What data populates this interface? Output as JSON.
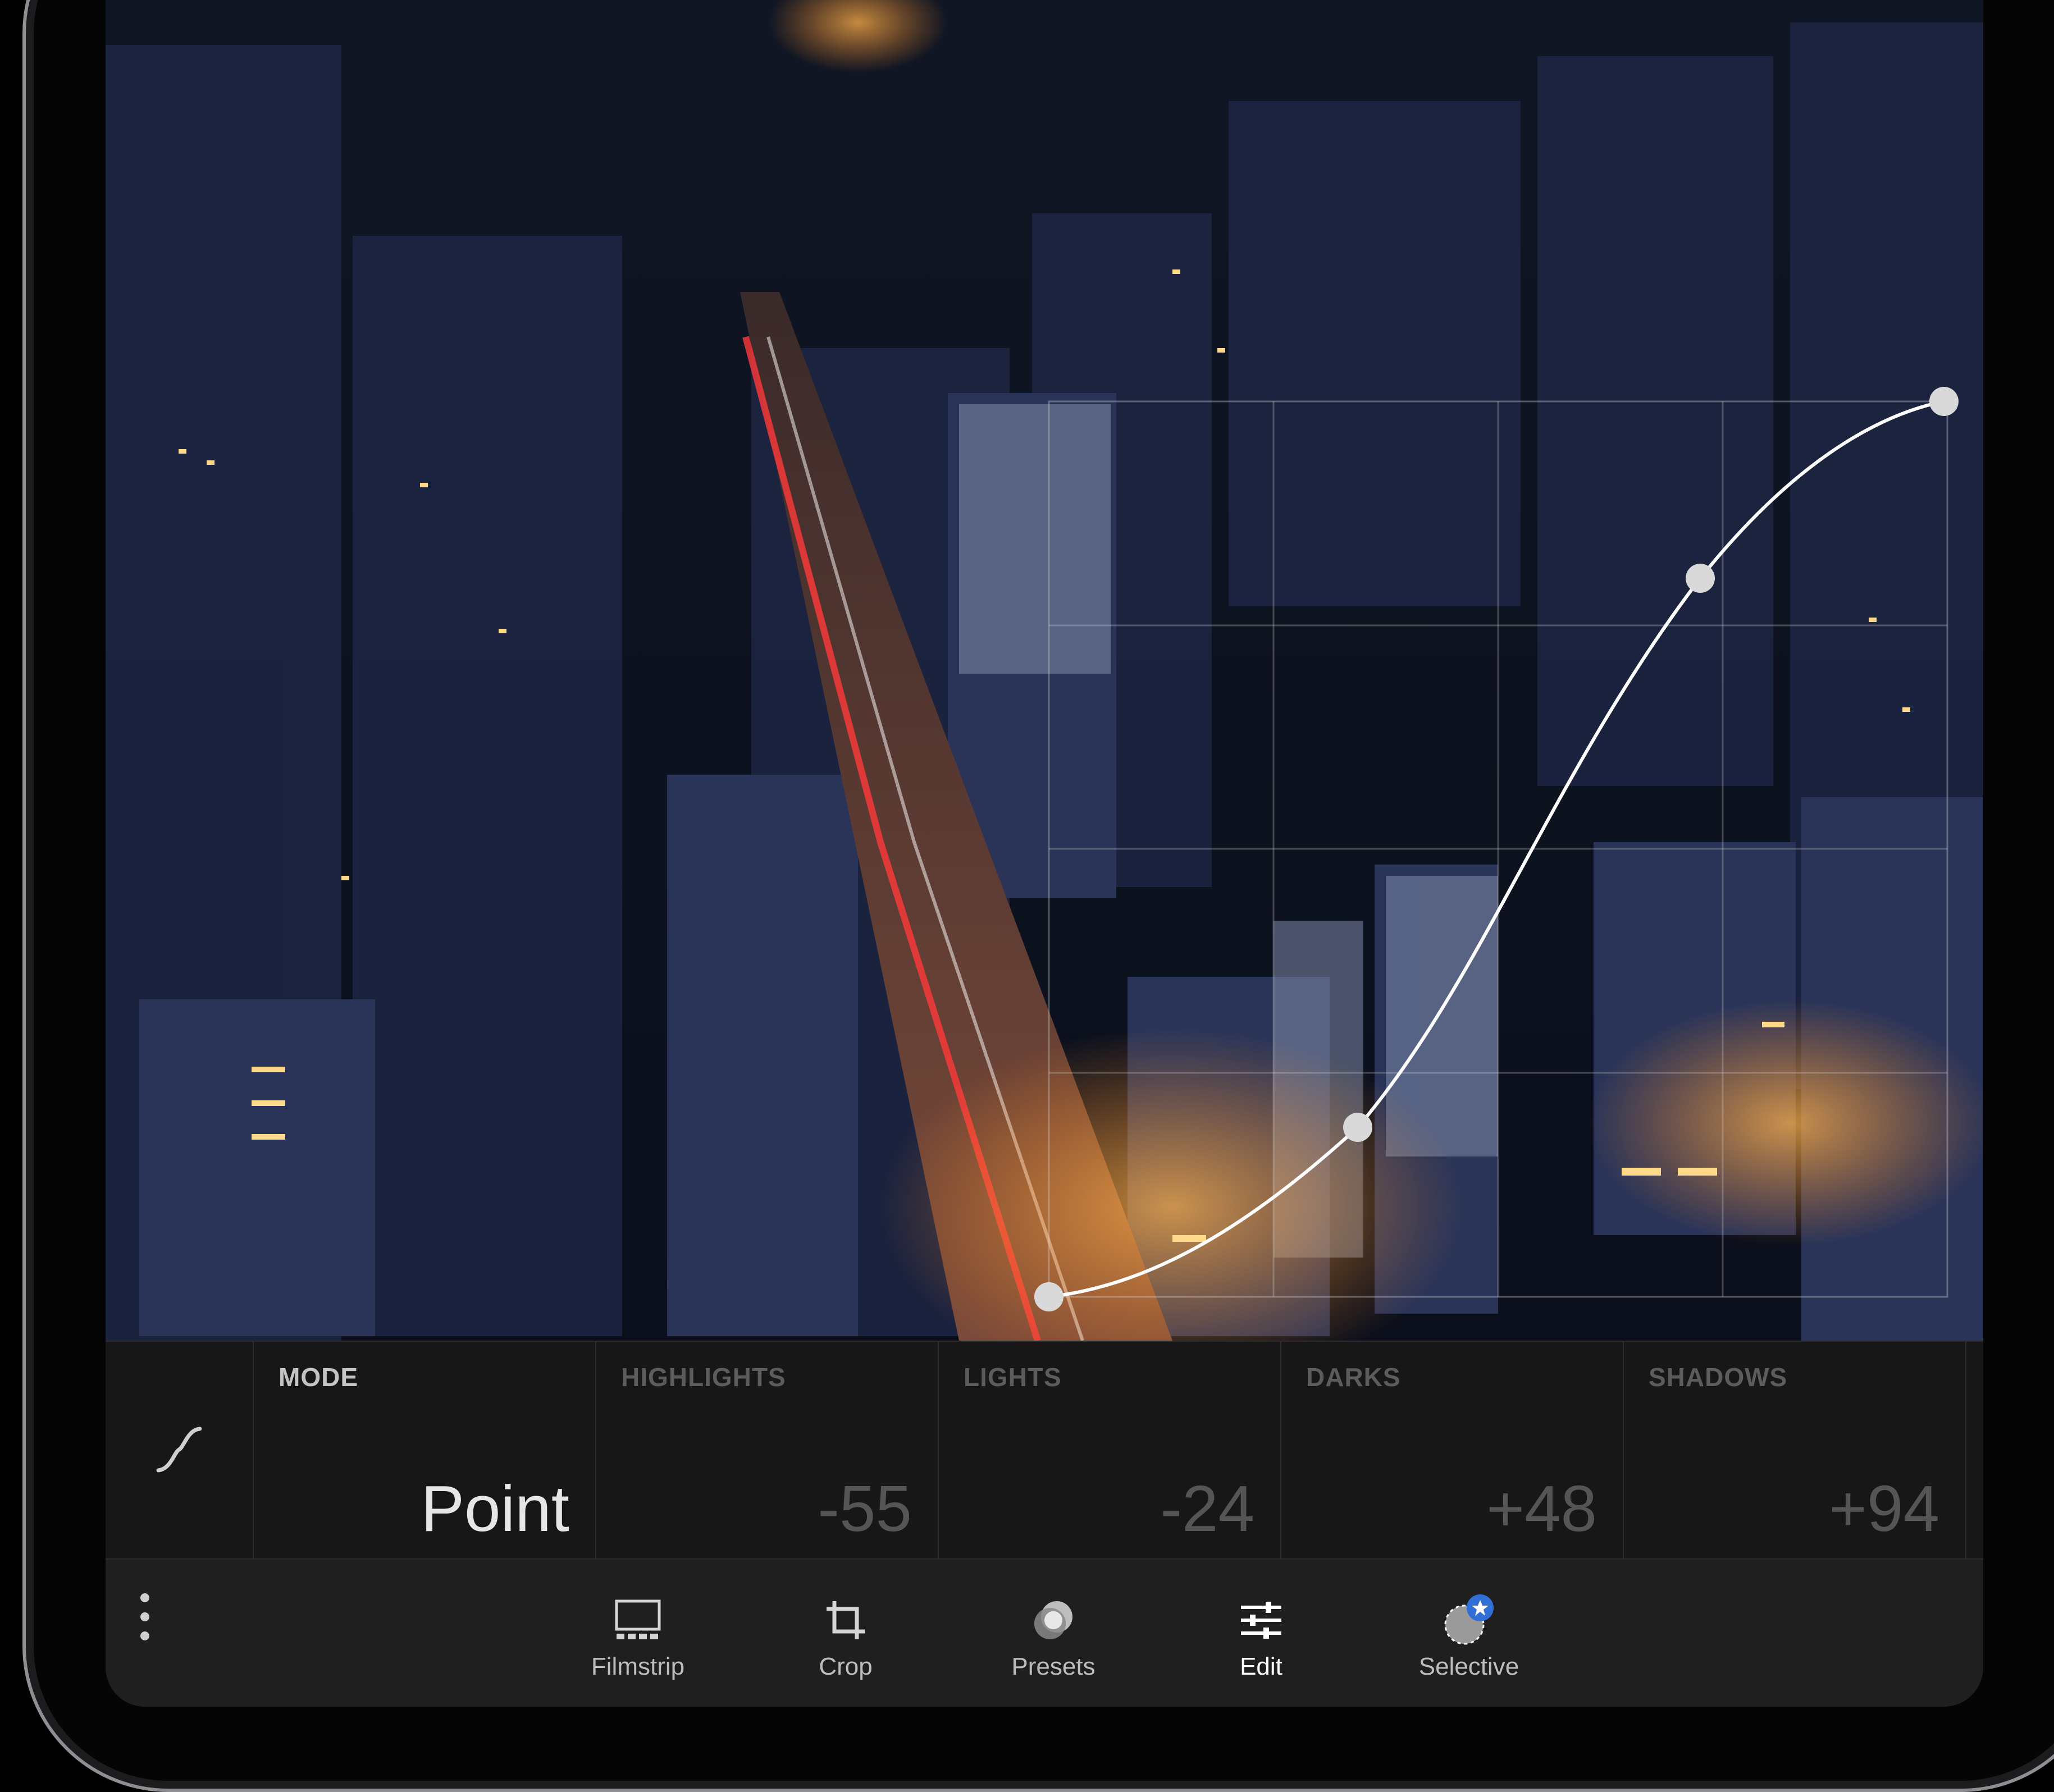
{
  "curve_panel": {
    "mode": {
      "label": "MODE",
      "value": "Point"
    },
    "highlights": {
      "label": "HIGHLIGHTS",
      "value": "-55"
    },
    "lights": {
      "label": "LIGHTS",
      "value": "-24"
    },
    "darks": {
      "label": "DARKS",
      "value": "+48"
    },
    "shadows": {
      "label": "SHADOWS",
      "value": "+94"
    }
  },
  "toolbar": {
    "filmstrip": "Filmstrip",
    "crop": "Crop",
    "presets": "Presets",
    "edit": "Edit",
    "selective": "Selective",
    "active": "Edit"
  },
  "icons": {
    "curve": "tone-curve-icon",
    "more": "more-vertical-icon",
    "filmstrip": "filmstrip-icon",
    "crop": "crop-icon",
    "presets": "presets-icon",
    "edit": "sliders-icon",
    "selective": "selective-icon"
  },
  "colors": {
    "accent_blue": "#2f6fd6",
    "panel_bg": "#171717",
    "active_text": "#ffffff",
    "inactive_text": "#5c5c5c"
  }
}
